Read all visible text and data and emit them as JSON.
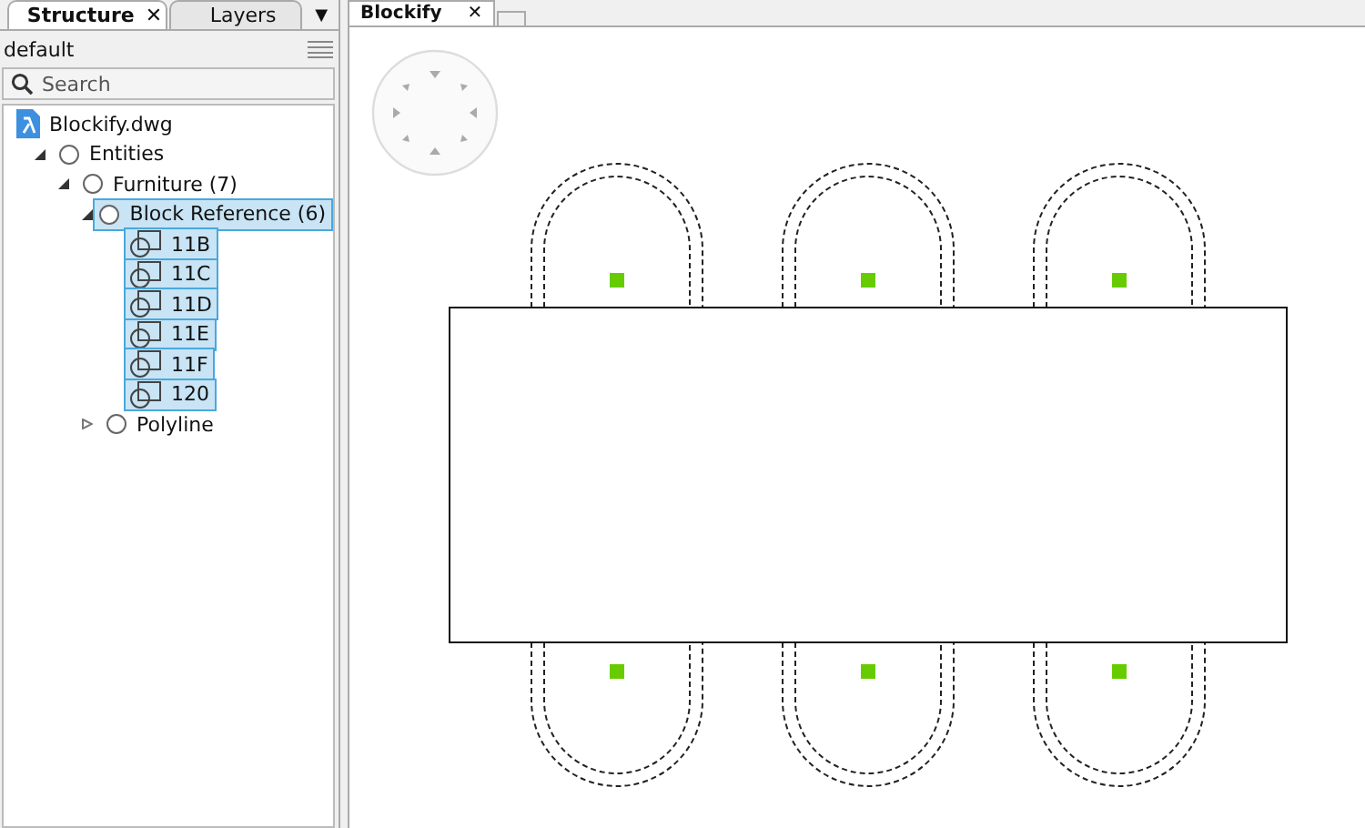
{
  "panel_tabs": [
    {
      "label": "Structure",
      "selected": true,
      "close": "✕"
    },
    {
      "label": "Layers",
      "selected": false
    }
  ],
  "panel_menu": "▼",
  "profile": "default",
  "search": {
    "placeholder": "Search"
  },
  "tree": [
    {
      "label": "Blockify.dwg",
      "kind": "file",
      "selected": false,
      "children": [
        {
          "label": "Entities",
          "kind": "group",
          "expanded": true,
          "selected": false,
          "children": [
            {
              "label": "Furniture (7)",
              "kind": "group",
              "expanded": true,
              "selected": false,
              "children": [
                {
                  "label": "Block Reference (6)",
                  "kind": "group",
                  "expanded": true,
                  "selected": true,
                  "children": [
                    {
                      "label": "11B",
                      "kind": "block",
                      "selected": true
                    },
                    {
                      "label": "11C",
                      "kind": "block",
                      "selected": true
                    },
                    {
                      "label": "11D",
                      "kind": "block",
                      "selected": true
                    },
                    {
                      "label": "11E",
                      "kind": "block",
                      "selected": true
                    },
                    {
                      "label": "11F",
                      "kind": "block",
                      "selected": true
                    },
                    {
                      "label": "120",
                      "kind": "block",
                      "selected": true
                    }
                  ]
                },
                {
                  "label": "Polyline",
                  "kind": "group",
                  "expanded": false,
                  "selected": false
                }
              ]
            }
          ]
        }
      ]
    }
  ],
  "document_tab": {
    "label": "Blockify",
    "close": "✕"
  }
}
